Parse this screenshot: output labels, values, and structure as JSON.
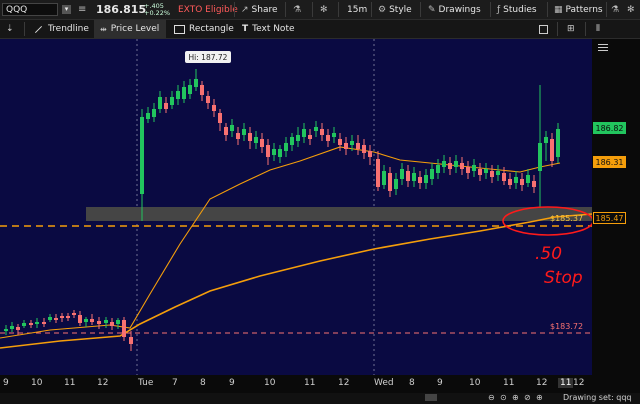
{
  "toolbar": {
    "symbol": "QQQ",
    "price": "186.815",
    "change_abs": "+.405",
    "change_pct": "+0.22%",
    "exto": "EXTO Eligible",
    "share": "Share",
    "interval": "15m",
    "style": "Style",
    "drawings": "Drawings",
    "studies": "Studies",
    "patterns": "Patterns"
  },
  "drawing_bar": {
    "trendline": "Trendline",
    "price_level": "Price Level",
    "rectangle": "Rectangle",
    "text_note": "Text Note"
  },
  "price_tags": {
    "close": "186.82",
    "ema_fast": "186.31",
    "ema_slow": "185.47"
  },
  "levels": {
    "upper": "$185.37",
    "lower": "$183.72"
  },
  "hi_label": "Hi: 187.72",
  "handwriting": {
    "line1": ".50",
    "line2": "Stop"
  },
  "x_labels": [
    "9",
    "10",
    "11",
    "12",
    "Tue",
    "7",
    "8",
    "9",
    "10",
    "11",
    "12",
    "Wed",
    "8",
    "9",
    "10",
    "11",
    "12",
    "11",
    "12"
  ],
  "status": {
    "drawing_set_label": "Drawing set: qqq"
  },
  "colors": {
    "chart_bg": "#0a0a42",
    "up": "#22c55e",
    "down": "#f87171",
    "ema": "#f59e0b"
  },
  "chart_data": {
    "type": "candlestick",
    "symbol": "QQQ",
    "interval": "15m",
    "price_levels": [
      185.37,
      183.72
    ],
    "hi": 187.72,
    "last": 186.82,
    "series": [
      {
        "values": [
          186.31
        ]
      },
      {
        "values": [
          185.47
        ]
      }
    ]
  }
}
